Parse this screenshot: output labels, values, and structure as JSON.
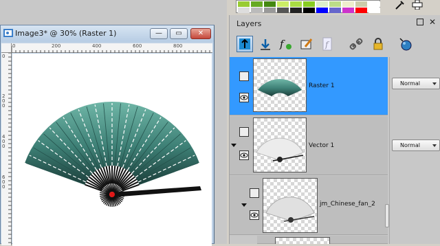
{
  "image_window": {
    "title": "Image3* @  30% (Raster 1)",
    "buttons": {
      "minimize": "—",
      "maximize": "▭",
      "close": "✕"
    },
    "ruler_top_labels": [
      "0",
      "200",
      "400",
      "600",
      "800"
    ],
    "ruler_left_labels": [
      "0",
      "2 0 0",
      "4 0 0",
      "6 0 0"
    ]
  },
  "palette": {
    "colors": [
      "#99cc33",
      "#66aa22",
      "#448811",
      "#ccee66",
      "#aadd44",
      "#88cc22",
      "#ddeecc",
      "#bbdd88",
      "#eeeecc",
      "#ccccaa",
      "#ffffff",
      "#dddddd",
      "#bbbbbb",
      "#999999",
      "#555555",
      "#222222",
      "#000000",
      "#0000ff",
      "#6666cc",
      "#cc33cc",
      "#ff0000",
      "#ffffff"
    ]
  },
  "layers_panel": {
    "title": "Layers",
    "toolbar_icons": [
      "move-layer-up-icon",
      "move-layer-down-icon",
      "new-layer-icon",
      "edit-icon",
      "script-icon",
      "link-icon",
      "lock-icon",
      "palette-icon"
    ],
    "layers": [
      {
        "name": "Raster 1",
        "blend_mode": "Normal",
        "selected": true
      },
      {
        "name": "Vector 1",
        "blend_mode": "Normal",
        "selected": false
      },
      {
        "name": "jm_Chinese_fan_2",
        "blend_mode": "",
        "selected": false
      }
    ]
  },
  "colors": {
    "selection": "#3399ff",
    "fan_top": "#5fa89a",
    "fan_bottom": "#1f4a46"
  }
}
